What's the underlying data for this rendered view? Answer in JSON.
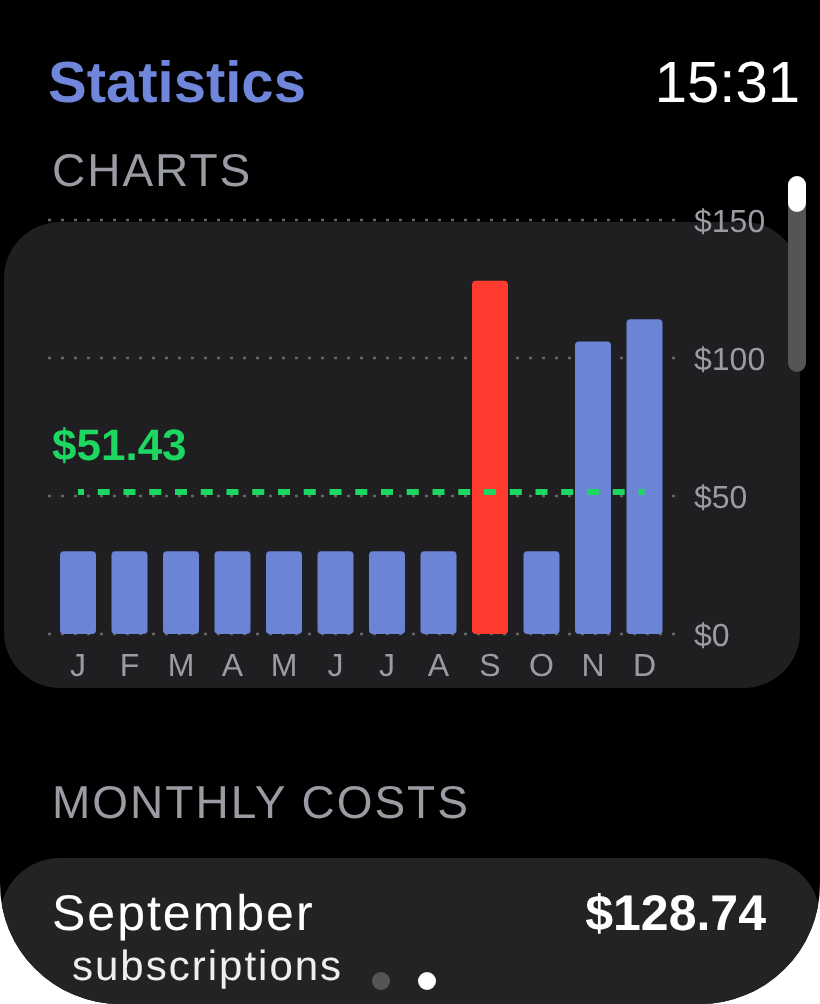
{
  "header": {
    "title": "Statistics",
    "time": "15:31"
  },
  "charts_section": {
    "heading": "CHARTS",
    "chart_data": {
      "type": "bar",
      "categories": [
        "J",
        "F",
        "M",
        "A",
        "M",
        "J",
        "J",
        "A",
        "S",
        "O",
        "N",
        "D"
      ],
      "series": [
        {
          "color": "#6b84d6",
          "values": [
            30,
            30,
            30,
            30,
            30,
            30,
            30,
            30,
            null,
            30,
            106,
            114
          ]
        },
        {
          "color": "#ff3b30",
          "values": [
            null,
            null,
            null,
            null,
            null,
            null,
            null,
            null,
            128,
            null,
            null,
            null
          ]
        },
        {
          "name": "$51.43",
          "type": "line",
          "line_style": "dashed",
          "color": "#1ed760",
          "values": [
            51.43,
            51.43,
            51.43,
            51.43,
            51.43,
            51.43,
            51.43,
            51.43,
            51.43,
            51.43,
            51.43,
            51.43
          ]
        }
      ],
      "yticks": [
        {
          "value": 0,
          "label": "$0"
        },
        {
          "value": 50,
          "label": "$50"
        },
        {
          "value": 100,
          "label": "$100"
        },
        {
          "value": 150,
          "label": "$150"
        }
      ],
      "ylim": [
        0,
        150
      ]
    }
  },
  "monthly_costs": {
    "heading": "MONTHLY COSTS",
    "month": "September",
    "amount": "$128.74",
    "category": "subscriptions"
  },
  "page_dots": [
    {
      "selected": false
    },
    {
      "selected": true
    }
  ]
}
